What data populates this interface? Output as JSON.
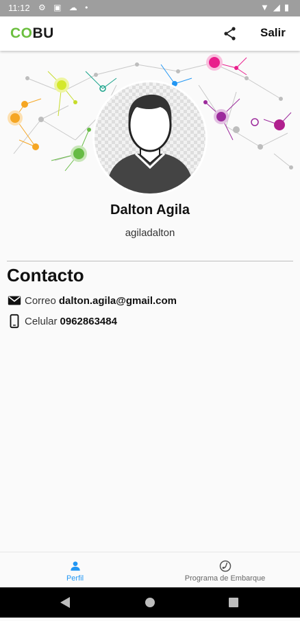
{
  "status_bar": {
    "time": "11:12"
  },
  "app_bar": {
    "logo_co": "CO",
    "logo_bu": "BU",
    "logout_label": "Salir"
  },
  "profile": {
    "name": "Dalton Agila",
    "username": "agiladalton"
  },
  "contact": {
    "title": "Contacto",
    "email_label": "Correo",
    "email_value": "dalton.agila@gmail.com",
    "phone_label": "Celular",
    "phone_value": "0962863484"
  },
  "bottom_nav": {
    "items": [
      {
        "label": "Perfil"
      },
      {
        "label": "Programa de Embarque"
      }
    ]
  },
  "colors": {
    "accent": "#2196f3",
    "logo_green": "#6cbf3f",
    "status_bar": "#9e9e9e"
  }
}
